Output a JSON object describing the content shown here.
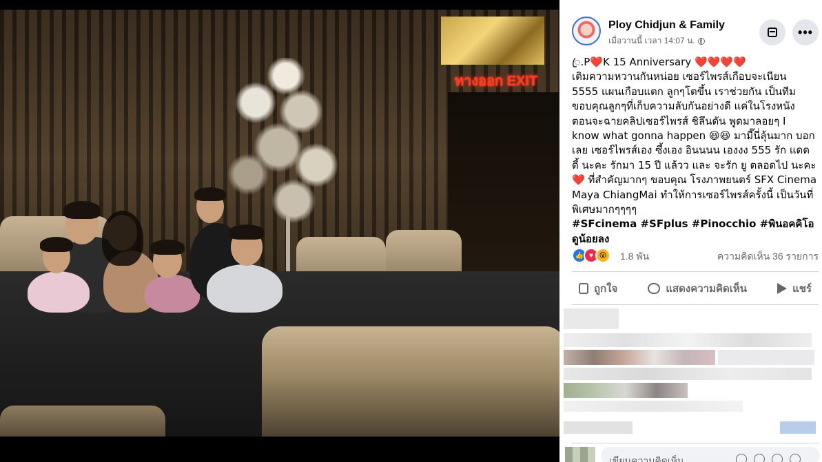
{
  "post": {
    "page_name": "Ploy Chidjun & Family",
    "timestamp": "เมื่อวานนี้ เวลา 14:07 น.",
    "privacy_icon": "globe-icon",
    "text_lines": [
      "ꦿ.P❤️K 15 Anniversary ❤️❤️❤️❤️",
      "เติมความหวานกันหน่อย เซอร์ไพรส์เกือบจะเนียน",
      "5555 แผนเกือบแตก ลูกๆโตขึ้น เราช่วยกัน เป็นทีม",
      "ขอบคุณลูกๆที่เก็บความลับกันอย่างดี แค่ในโรงหนัง",
      "ตอนจะฉายคลิปเซอร์ไพรส์ ชิลึนดัน พูดมาลอยๆ I",
      "know what gonna happen 😆😆 มามี๊นี่ลุ้นมาก บอก",
      "เลย เซอร์ไพรส์เอง ซึ้งเอง อินนนน เองงง 555 รัก แดด",
      "ดี้ นะคะ รักมา 15 ปี แล้วว และ จะรัก ยู ตลอดไป นะคะ",
      "❤️ ที่สำคัญมากๆ ขอบคุณ โรงภาพยนตร์ SFX Cinema",
      "Maya ChiangMai ทำให้การเซอร์ไพรส์ครั้งนี้ เป็นวันที่",
      "พิเศษมากๆๆๆๆ"
    ],
    "hashtags_line1": "#SFcinema #SFplus #Pinocchio #พินอคคิโอ",
    "hashtags_line2": "ดูน้อยลง"
  },
  "reactions": {
    "icons": [
      "like-icon",
      "love-icon",
      "wow-icon"
    ],
    "count": "1.8 พัน",
    "comments": "ความคิดเห็น 36 รายการ"
  },
  "actions": {
    "like": "ถูกใจ",
    "comment": "แสดงความคิดเห็น",
    "share": "แชร์"
  },
  "comment_box": {
    "placeholder": "เขียนความคิดเห็น..."
  },
  "media": {
    "sign_text": "ทางออก EXIT"
  },
  "colors": {
    "accent": "#1877f2",
    "love": "#f0284a",
    "exit_sign": "#ff3a22"
  }
}
